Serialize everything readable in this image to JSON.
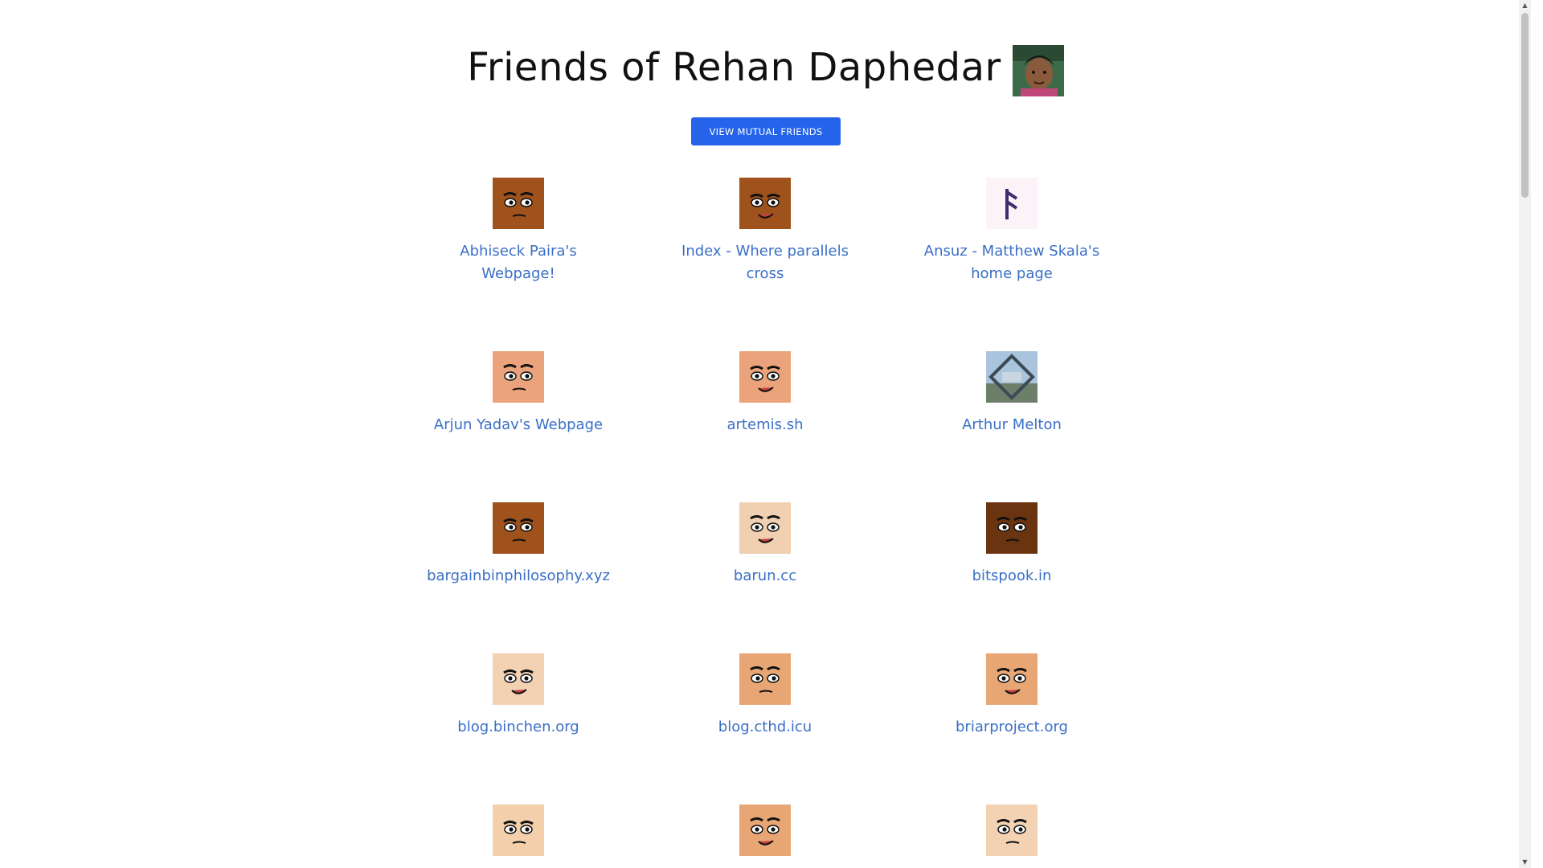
{
  "header": {
    "title": "Friends of Rehan Daphedar"
  },
  "actions": {
    "mutual_label": "VIEW MUTUAL FRIENDS"
  },
  "friends": [
    {
      "label": "Abhiseck Paira's Webpage!",
      "face": "face-1",
      "skin": "#a0521d"
    },
    {
      "label": "Index - Where parallels cross",
      "face": "face-2",
      "skin": "#a0521d"
    },
    {
      "label": "Ansuz - Matthew Skala's home page",
      "face": "rune",
      "skin": "#fbf3f8"
    },
    {
      "label": "Arjun Yadav's Webpage",
      "face": "face-3",
      "skin": "#eaa37a"
    },
    {
      "label": "artemis.sh",
      "face": "face-4",
      "skin": "#eaa37a"
    },
    {
      "label": "Arthur Melton",
      "face": "photo",
      "skin": "#5a7f9e"
    },
    {
      "label": "bargainbinphilosophy.xyz",
      "face": "face-5",
      "skin": "#a0521d"
    },
    {
      "label": "barun.cc",
      "face": "face-6",
      "skin": "#f0d0b0"
    },
    {
      "label": "bitspook.in",
      "face": "face-7",
      "skin": "#6b3410"
    },
    {
      "label": "blog.binchen.org",
      "face": "face-8",
      "skin": "#f3d2b4"
    },
    {
      "label": "blog.cthd.icu",
      "face": "face-9",
      "skin": "#e9a675"
    },
    {
      "label": "briarproject.org",
      "face": "face-10",
      "skin": "#e9a675"
    },
    {
      "label": "",
      "face": "face-11",
      "skin": "#f3d0ab"
    },
    {
      "label": "",
      "face": "face-12",
      "skin": "#e9a675"
    },
    {
      "label": "",
      "face": "face-13",
      "skin": "#f3d2b4"
    }
  ],
  "colors": {
    "link": "#3a6fc7",
    "button": "#2563eb"
  }
}
